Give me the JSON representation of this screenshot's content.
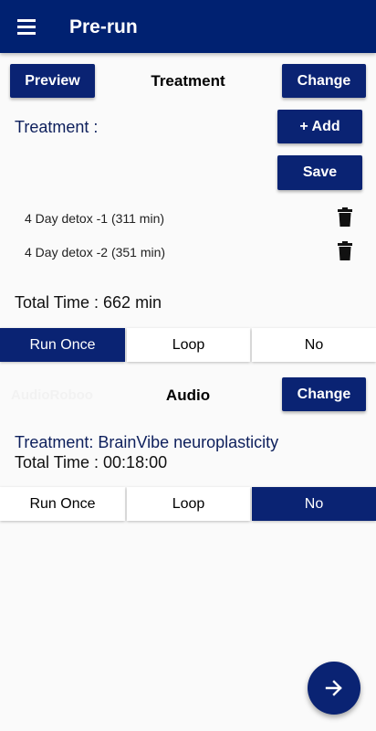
{
  "app_bar": {
    "title": "Pre-run",
    "menu_icon": "menu-icon"
  },
  "treatment_section": {
    "preview_label": "Preview",
    "title": "Treatment",
    "change_label": "Change",
    "treatment_label": "Treatment :",
    "add_label": "+ Add",
    "save_label": "Save",
    "items": [
      {
        "name": "4 Day detox -1 (311 min)",
        "icon": "delete-icon"
      },
      {
        "name": "4 Day detox -2 (351 min)",
        "icon": "delete-icon"
      }
    ],
    "total_time": "Total Time : 662 min",
    "mode_options": [
      "Run Once",
      "Loop",
      "No"
    ],
    "selected_mode": "Run Once"
  },
  "audio_section": {
    "faint_label": "AudioRoboo",
    "title": "Audio",
    "change_label": "Change",
    "treatment": "Treatment: BrainVibe neuroplasticity",
    "total_time": "Total Time : 00:18:00",
    "mode_options": [
      "Run Once",
      "Loop",
      "No"
    ],
    "selected_mode": "No"
  },
  "fab": {
    "icon": "arrow-right-icon"
  },
  "colors": {
    "primary": "#002171",
    "button": "#0a2373",
    "accent_text": "#0d1f5c",
    "background": "#fafafa"
  }
}
